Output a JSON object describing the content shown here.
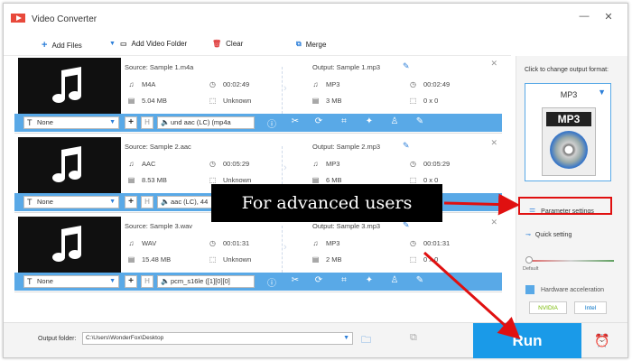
{
  "window": {
    "title": "Video Converter"
  },
  "toolbar": {
    "add_files": "Add Files",
    "add_video_folder": "Add Video Folder",
    "clear": "Clear",
    "merge": "Merge"
  },
  "files": [
    {
      "source": "Source: Sample 1.m4a",
      "output": "Output: Sample 1.mp3",
      "src_format": "M4A",
      "src_duration": "00:02:49",
      "src_size": "5.04 MB",
      "src_resolution": "Unknown",
      "out_format": "MP3",
      "out_duration": "00:02:49",
      "out_size": "3 MB",
      "out_resolution": "0 x 0",
      "subtitle": "None",
      "audio_track": "und aac (LC) (mp4a"
    },
    {
      "source": "Source: Sample 2.aac",
      "output": "Output: Sample 2.mp3",
      "src_format": "AAC",
      "src_duration": "00:05:29",
      "src_size": "8.53 MB",
      "src_resolution": "Unknown",
      "out_format": "MP3",
      "out_duration": "00:05:29",
      "out_size": "6 MB",
      "out_resolution": "0 x 0",
      "subtitle": "None",
      "audio_track": "aac (LC), 44"
    },
    {
      "source": "Source: Sample 3.wav",
      "output": "Output: Sample 3.mp3",
      "src_format": "WAV",
      "src_duration": "00:01:31",
      "src_size": "15.48 MB",
      "src_resolution": "Unknown",
      "out_format": "MP3",
      "out_duration": "00:01:31",
      "out_size": "2 MB",
      "out_resolution": "0 x 0",
      "subtitle": "None",
      "audio_track": "pcm_s16le ([1][0][0]"
    }
  ],
  "right_panel": {
    "title": "Click to change output format:",
    "format_name": "MP3",
    "format_badge": "MP3",
    "parameter_settings": "Parameter settings",
    "quick_setting": "Quick setting",
    "slider_default": "Default",
    "hardware_acceleration": "Hardware acceleration",
    "nvidia": "NVIDIA",
    "intel": "Intel"
  },
  "bottom": {
    "output_folder_label": "Output folder:",
    "output_folder_path": "C:\\Users\\WonderFox\\Desktop",
    "run": "Run"
  },
  "annotation": {
    "label": "For advanced users",
    "color": "#e01010"
  }
}
